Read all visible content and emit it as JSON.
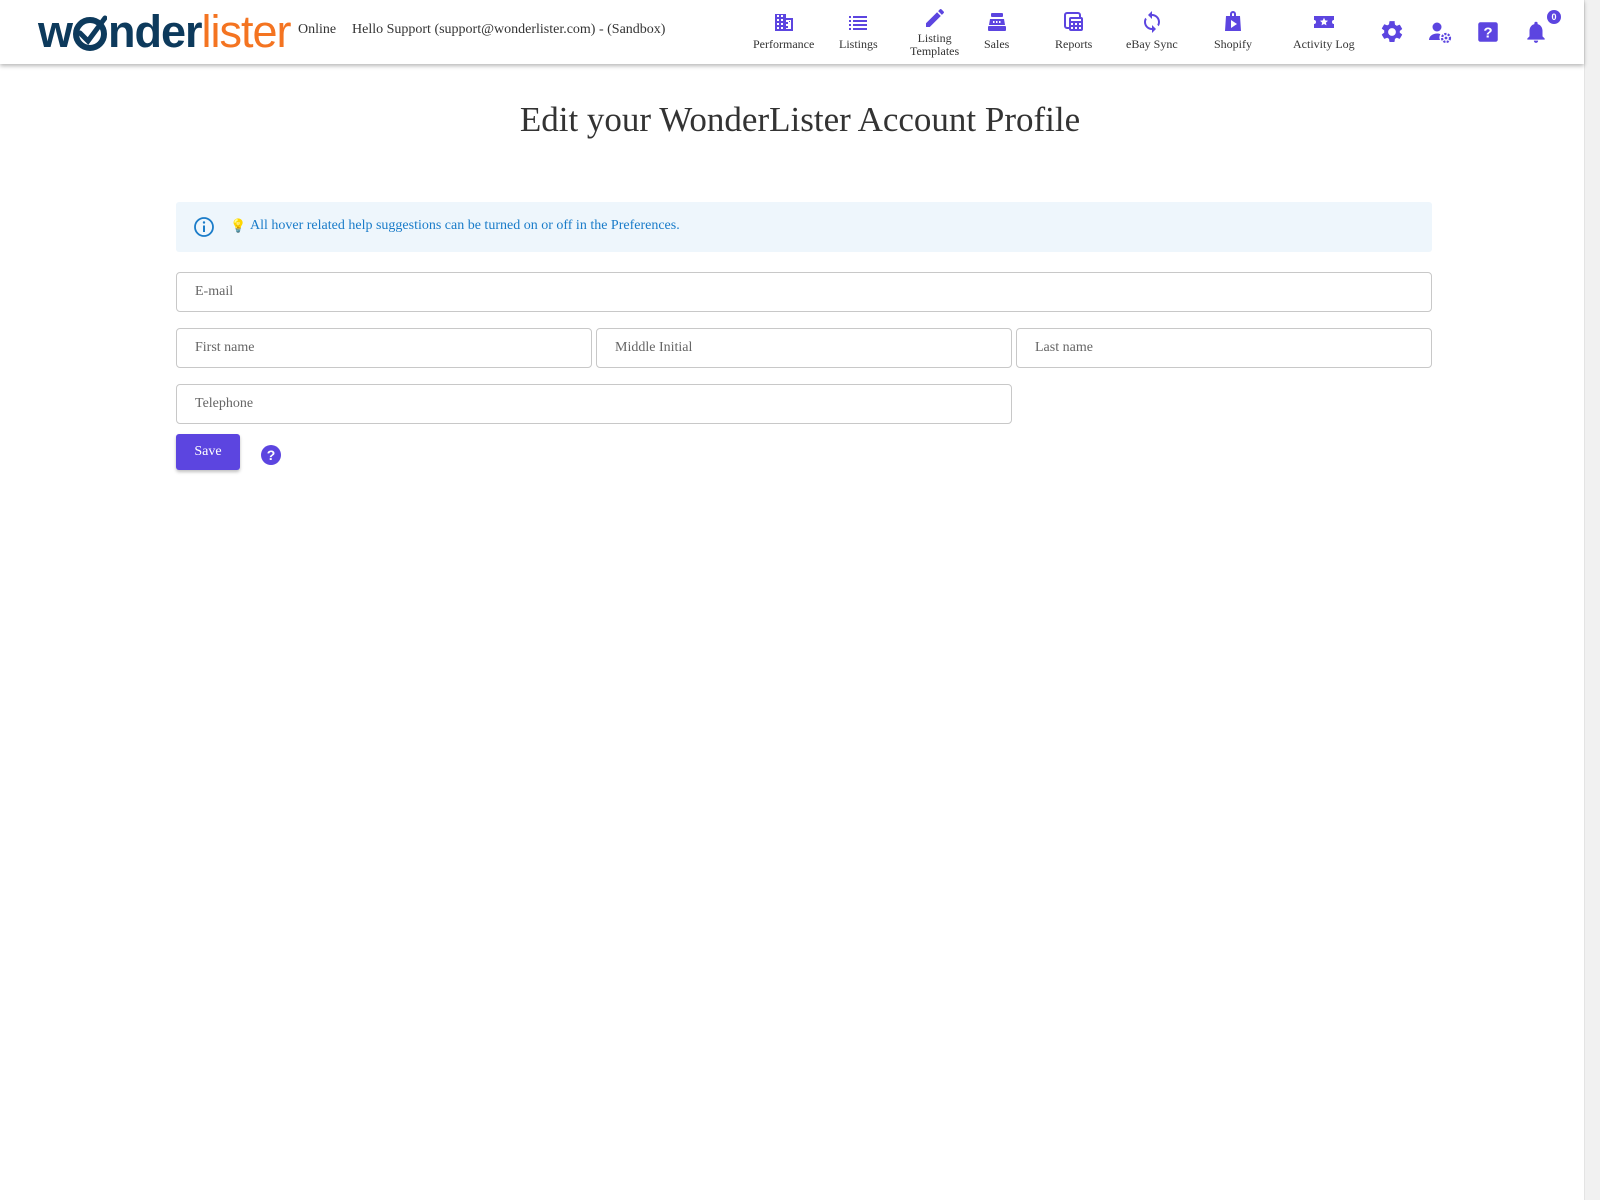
{
  "brand": {
    "logo_part1": "w",
    "logo_part2": "nder",
    "logo_part3": "lister",
    "logo_label": "wonderlister"
  },
  "header": {
    "status": "Online",
    "greeting": "Hello Support (support@wonderlister.com) - (Sandbox)",
    "nav": [
      {
        "label": "Performance",
        "icon": "building-icon"
      },
      {
        "label": "Listings",
        "icon": "list-icon"
      },
      {
        "label": "Listing\nTemplates",
        "icon": "pencil-icon"
      },
      {
        "label": "Sales",
        "icon": "cash-register-icon"
      },
      {
        "label": "Reports",
        "icon": "calculator-icon"
      },
      {
        "label": "eBay Sync",
        "icon": "sync-icon"
      },
      {
        "label": "Shopify",
        "icon": "shopping-bag-icon"
      },
      {
        "label": "Activity Log",
        "icon": "ticket-star-icon"
      }
    ],
    "icons": [
      "gear-icon",
      "user-settings-icon",
      "help-icon",
      "bell-icon"
    ],
    "notification_count": "0"
  },
  "main": {
    "title": "Edit your WonderLister Account Profile",
    "info_bulb": "💡",
    "info_message": "All hover related help suggestions can be turned on or off in the Preferences.",
    "form": {
      "email": {
        "placeholder": "E-mail",
        "value": ""
      },
      "first_name": {
        "placeholder": "First name",
        "value": ""
      },
      "middle_initial": {
        "placeholder": "Middle Initial",
        "value": ""
      },
      "last_name": {
        "placeholder": "Last name",
        "value": ""
      },
      "telephone": {
        "placeholder": "Telephone",
        "value": ""
      },
      "save_label": "Save"
    }
  },
  "colors": {
    "accent": "#5c45e0",
    "logo_blue": "#0d3a5c",
    "logo_orange": "#f47421",
    "info_bg": "#eef6fc",
    "info_text": "#1a7cc9"
  }
}
